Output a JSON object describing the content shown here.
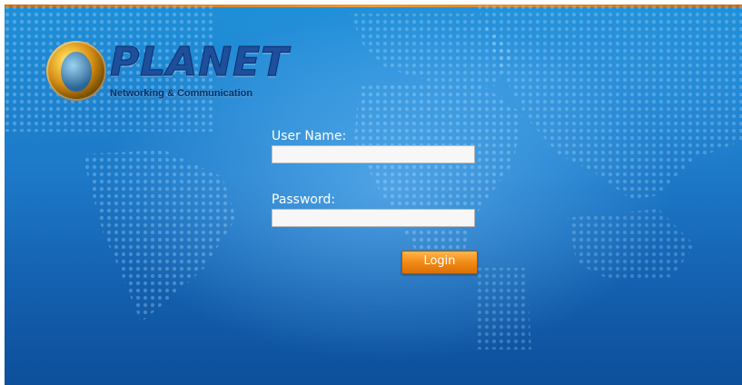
{
  "brand": {
    "name": "PLANET",
    "tagline": "Networking & Communication"
  },
  "login": {
    "username_label": "User Name:",
    "username_value": "",
    "password_label": "Password:",
    "password_value": "",
    "submit_label": "Login"
  },
  "theme": {
    "background_accent": "#1d79c8",
    "button_color": "#f28a16",
    "top_border_color": "#e99b3b"
  }
}
